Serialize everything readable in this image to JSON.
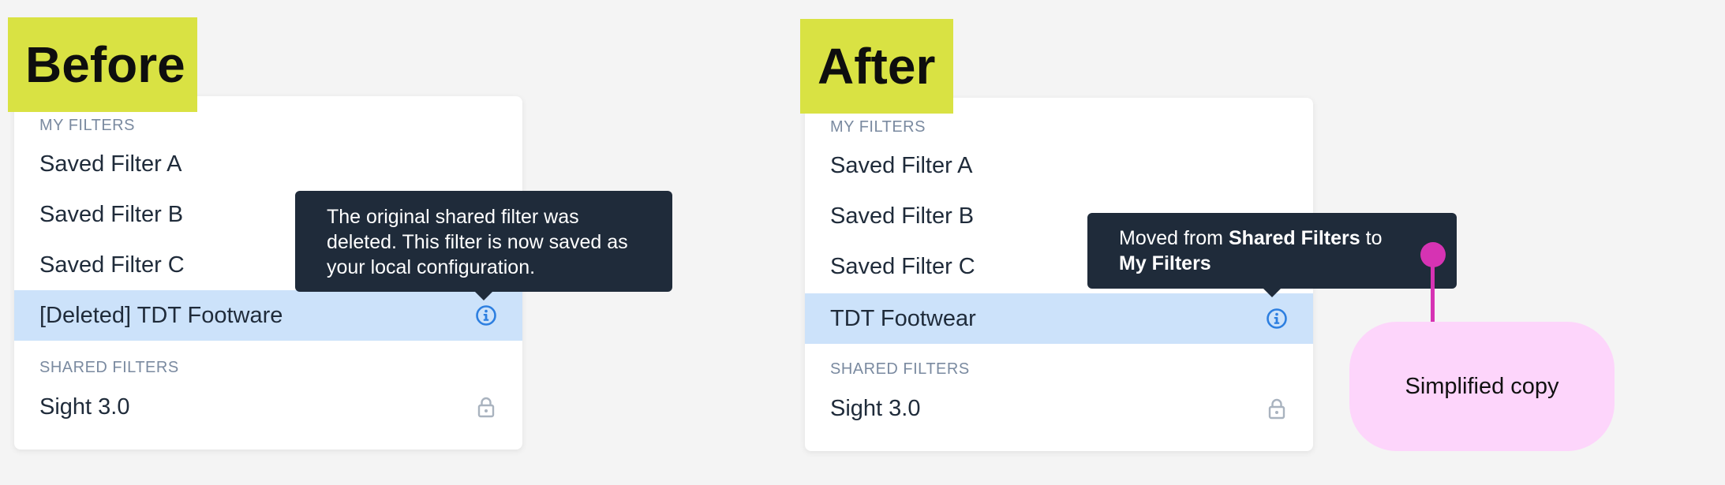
{
  "before": {
    "tag": "Before",
    "my_filters_label": "MY FILTERS",
    "my_filters": [
      "Saved Filter A",
      "Saved Filter B",
      "Saved Filter C"
    ],
    "selected_item": "[Deleted] TDT Footware",
    "tooltip_text": "The original shared filter was deleted. This filter is now saved as your local configuration.",
    "shared_filters_label": "SHARED FILTERS",
    "shared_filters": [
      "Sight 3.0"
    ]
  },
  "after": {
    "tag": "After",
    "my_filters_label": "MY FILTERS",
    "my_filters": [
      "Saved Filter A",
      "Saved Filter B",
      "Saved Filter C"
    ],
    "selected_item": "TDT Footwear",
    "tooltip": {
      "prefix": "Moved from ",
      "source": "Shared Filters",
      "middle": " to",
      "destination": "My Filters"
    },
    "shared_filters_label": "SHARED FILTERS",
    "shared_filters": [
      "Sight 3.0"
    ]
  },
  "annotation": {
    "text": "Simplified copy",
    "color": "#d633b3",
    "bubble_color": "#fdd5fb"
  },
  "colors": {
    "tag_background": "#d9e243",
    "selected_row": "#cce2fa",
    "tooltip_background": "#1f2b3a",
    "info_icon": "#2d7fe0",
    "lock_icon": "#a9b3bf"
  },
  "icons": {
    "info": "info-circle-icon",
    "lock": "lock-icon"
  }
}
